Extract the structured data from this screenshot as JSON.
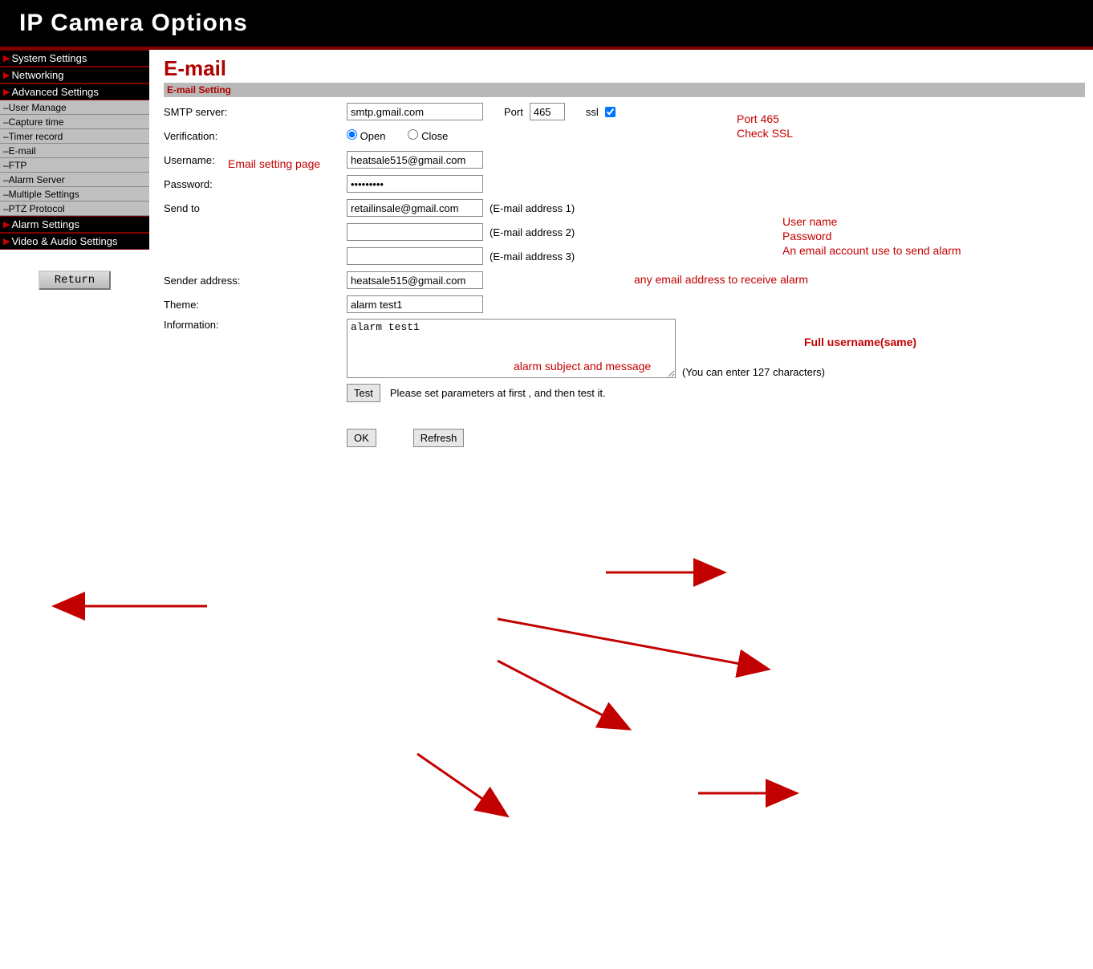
{
  "header": {
    "title": "IP Camera Options"
  },
  "sidebar": {
    "items": [
      {
        "type": "main",
        "label": "System Settings"
      },
      {
        "type": "main",
        "label": "Networking"
      },
      {
        "type": "main",
        "label": "Advanced Settings"
      },
      {
        "type": "sub",
        "label": "–User Manage"
      },
      {
        "type": "sub",
        "label": "–Capture time"
      },
      {
        "type": "sub",
        "label": "–Timer record"
      },
      {
        "type": "sub",
        "label": "–E-mail"
      },
      {
        "type": "sub",
        "label": "–FTP"
      },
      {
        "type": "sub",
        "label": "–Alarm Server"
      },
      {
        "type": "sub",
        "label": "–Multiple Settings"
      },
      {
        "type": "sub",
        "label": "–PTZ Protocol"
      },
      {
        "type": "main",
        "label": "Alarm Settings"
      },
      {
        "type": "main",
        "label": "Video & Audio Settings"
      }
    ],
    "return_label": "Return"
  },
  "page": {
    "title": "E-mail",
    "section": "E-mail Setting"
  },
  "labels": {
    "smtp": "SMTP server:",
    "port": "Port",
    "ssl": "ssl",
    "verification": "Verification:",
    "open": "Open",
    "close": "Close",
    "username": "Username:",
    "password": "Password:",
    "sendto": "Send to",
    "addr1": "(E-mail address 1)",
    "addr2": "(E-mail address 2)",
    "addr3": "(E-mail address 3)",
    "sender": "Sender address:",
    "theme": "Theme:",
    "info": "Information:",
    "chars_hint": "(You can enter 127 characters)",
    "test": "Test",
    "test_hint": "Please set parameters at first ,  and then test it.",
    "ok": "OK",
    "refresh": "Refresh"
  },
  "values": {
    "smtp": "smtp.gmail.com",
    "port": "465",
    "ssl_checked": true,
    "verification": "open",
    "username": "heatsale515@gmail.com",
    "password": "•••••••••",
    "sendto1": "retailinsale@gmail.com",
    "sendto2": "",
    "sendto3": "",
    "sender": "heatsale515@gmail.com",
    "theme": "alarm test1",
    "info": "alarm test1"
  },
  "annotations": {
    "email_page": "Email setting page",
    "port_ssl_1": "Port 465",
    "port_ssl_2": "Check SSL",
    "user_block_1": "User name",
    "user_block_2": "Password",
    "user_block_3": "An email account use to send alarm",
    "recv": "any email address to receive alarm",
    "subject": "alarm subject and message",
    "fulluser": "Full username(same)"
  }
}
